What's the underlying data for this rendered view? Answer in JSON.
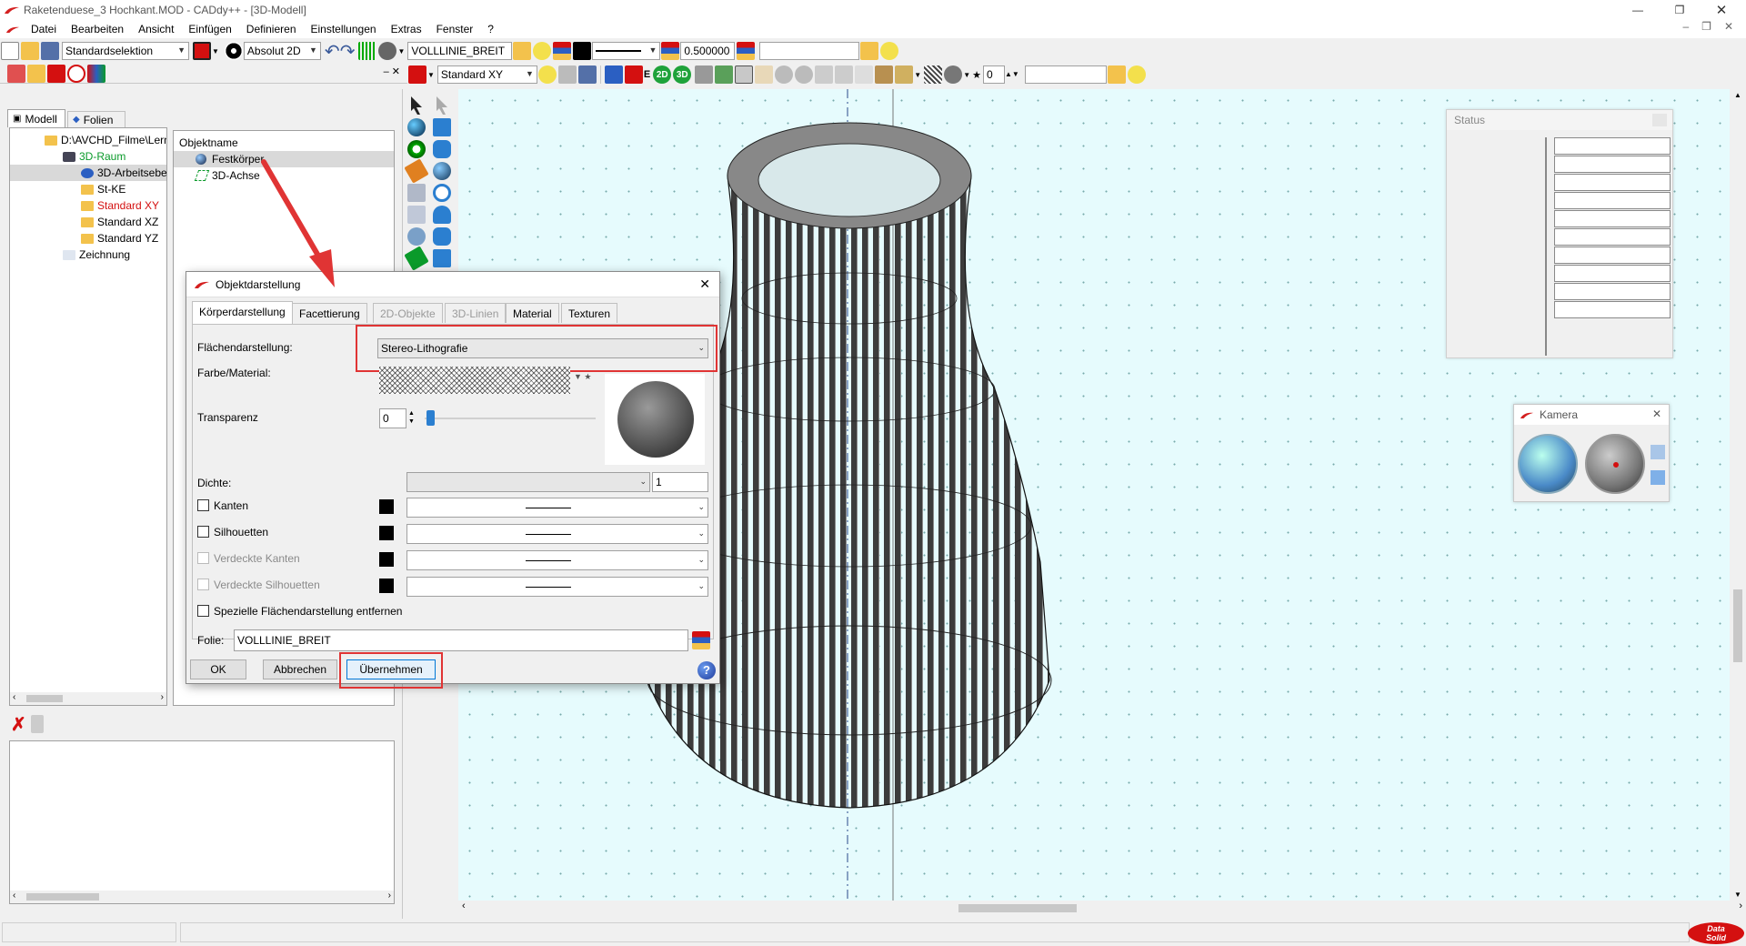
{
  "window": {
    "title": "Raketenduese_3 Hochkant.MOD  -  CADdy++ - [3D-Modell]",
    "accent": "#d42020"
  },
  "menu": [
    "Datei",
    "Bearbeiten",
    "Ansicht",
    "Einfügen",
    "Definieren",
    "Einstellungen",
    "Extras",
    "Fenster",
    "?"
  ],
  "toolbar1": {
    "selection": "Standardselektion",
    "mode": "Absolut 2D",
    "layer": "VOLLLINIE_BREIT",
    "lineweight": "0.500000",
    "empty_field": ""
  },
  "toolbar2": {
    "view": "Standard XY",
    "badge_2d": "2D",
    "badge_3d": "3D",
    "number": "0",
    "empty_field": ""
  },
  "left_tabs": {
    "modell": "Modell",
    "folien": "Folien"
  },
  "tree": [
    {
      "label": "D:\\AVCHD_Filme\\Lern",
      "color": "#000"
    },
    {
      "label": "3D-Raum",
      "color": "#0a9a2a"
    },
    {
      "label": "3D-Arbeitsebe",
      "color": "#000"
    },
    {
      "label": "St-KE",
      "color": "#000"
    },
    {
      "label": "Standard XY",
      "color": "#d41010"
    },
    {
      "label": "Standard XZ",
      "color": "#000"
    },
    {
      "label": "Standard YZ",
      "color": "#000"
    },
    {
      "label": "Zeichnung",
      "color": "#000"
    }
  ],
  "objects": {
    "header": "Objektname",
    "items": [
      "Festkörper",
      "3D-Achse"
    ]
  },
  "dialog": {
    "title": "Objektdarstellung",
    "tabs": [
      "Körperdarstellung",
      "Facettierung",
      "2D-Objekte",
      "3D-Linien",
      "Material",
      "Texturen"
    ],
    "surface_label": "Flächendarstellung:",
    "surface_value": "Stereo-Lithografie",
    "color_label": "Farbe/Material:",
    "transparency_label": "Transparenz",
    "transparency_value": "0",
    "density_label": "Dichte:",
    "density_value": "1",
    "kanten": "Kanten",
    "silhouetten": "Silhouetten",
    "verdeckte_kanten": "Verdeckte Kanten",
    "verdeckte_silhouetten": "Verdeckte Silhouetten",
    "remove_special": "Spezielle Flächendarstellung entfernen",
    "folie_label": "Folie:",
    "folie_value": "VOLLLINIE_BREIT",
    "ok": "OK",
    "cancel": "Abbrechen",
    "apply": "Übernehmen",
    "help": "?"
  },
  "status_panel": {
    "title": "Status"
  },
  "camera_panel": {
    "title": "Kamera"
  },
  "brand": {
    "line1": "Data",
    "line2": "Solid"
  }
}
